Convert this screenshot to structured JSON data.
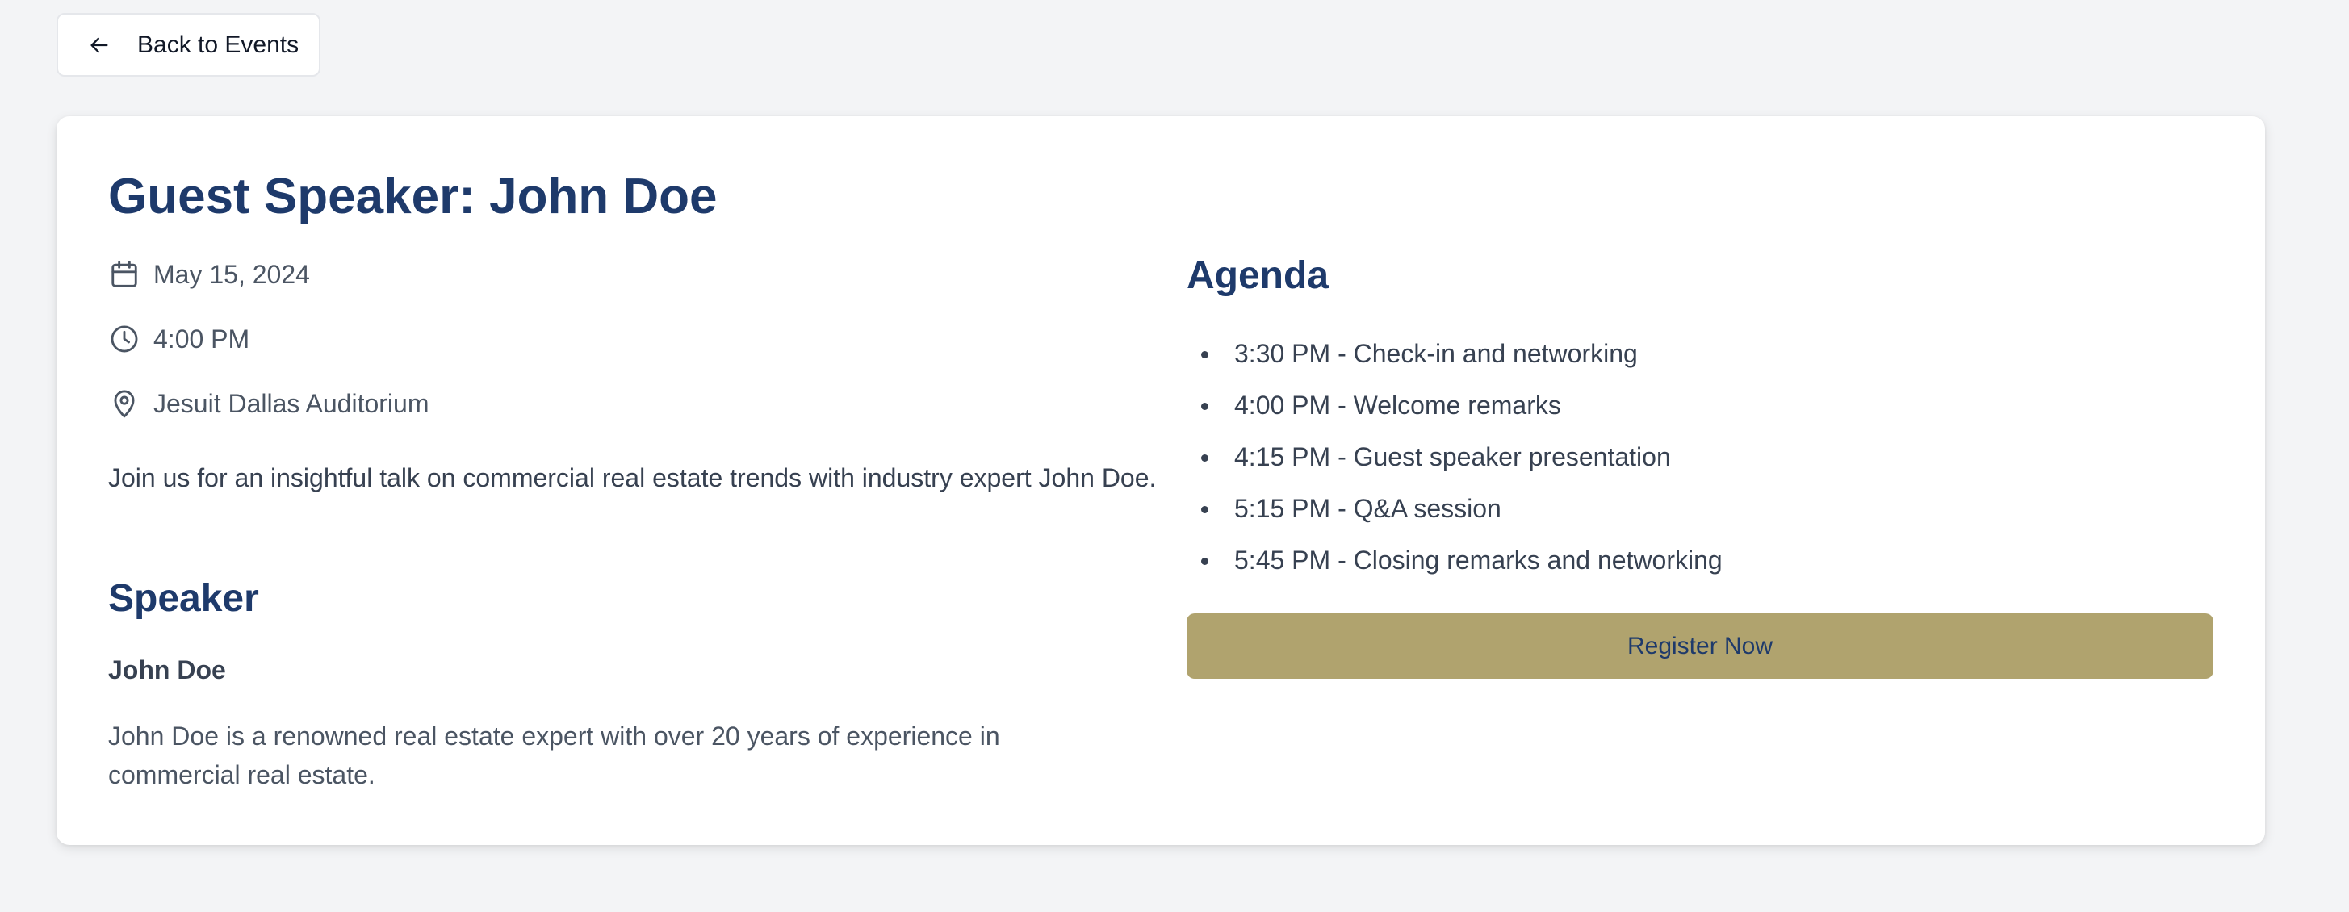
{
  "nav": {
    "back_label": "Back to Events",
    "back_icon": "arrow-left-icon"
  },
  "event": {
    "title": "Guest Speaker: John Doe",
    "date": "May 15, 2024",
    "time": "4:00 PM",
    "location": "Jesuit Dallas Auditorium",
    "description": "Join us for an insightful talk on commercial real estate trends with industry expert John Doe.",
    "icons": {
      "date": "calendar-icon",
      "time": "clock-icon",
      "location": "map-pin-icon"
    }
  },
  "speaker": {
    "heading": "Speaker",
    "name": "John Doe",
    "bio": "John Doe is a renowned real estate expert with over 20 years of experience in commercial real estate."
  },
  "agenda": {
    "heading": "Agenda",
    "items": [
      "3:30 PM - Check-in and networking",
      "4:00 PM - Welcome remarks",
      "4:15 PM - Guest speaker presentation",
      "5:15 PM - Q&A session",
      "5:45 PM - Closing remarks and networking"
    ]
  },
  "actions": {
    "register_label": "Register Now"
  },
  "colors": {
    "page_background": "#f3f4f6",
    "card_background": "#ffffff",
    "heading": "#1e3a6b",
    "register_button": "#b0a36e",
    "body_text": "#374151",
    "muted_text": "#4b5563"
  }
}
